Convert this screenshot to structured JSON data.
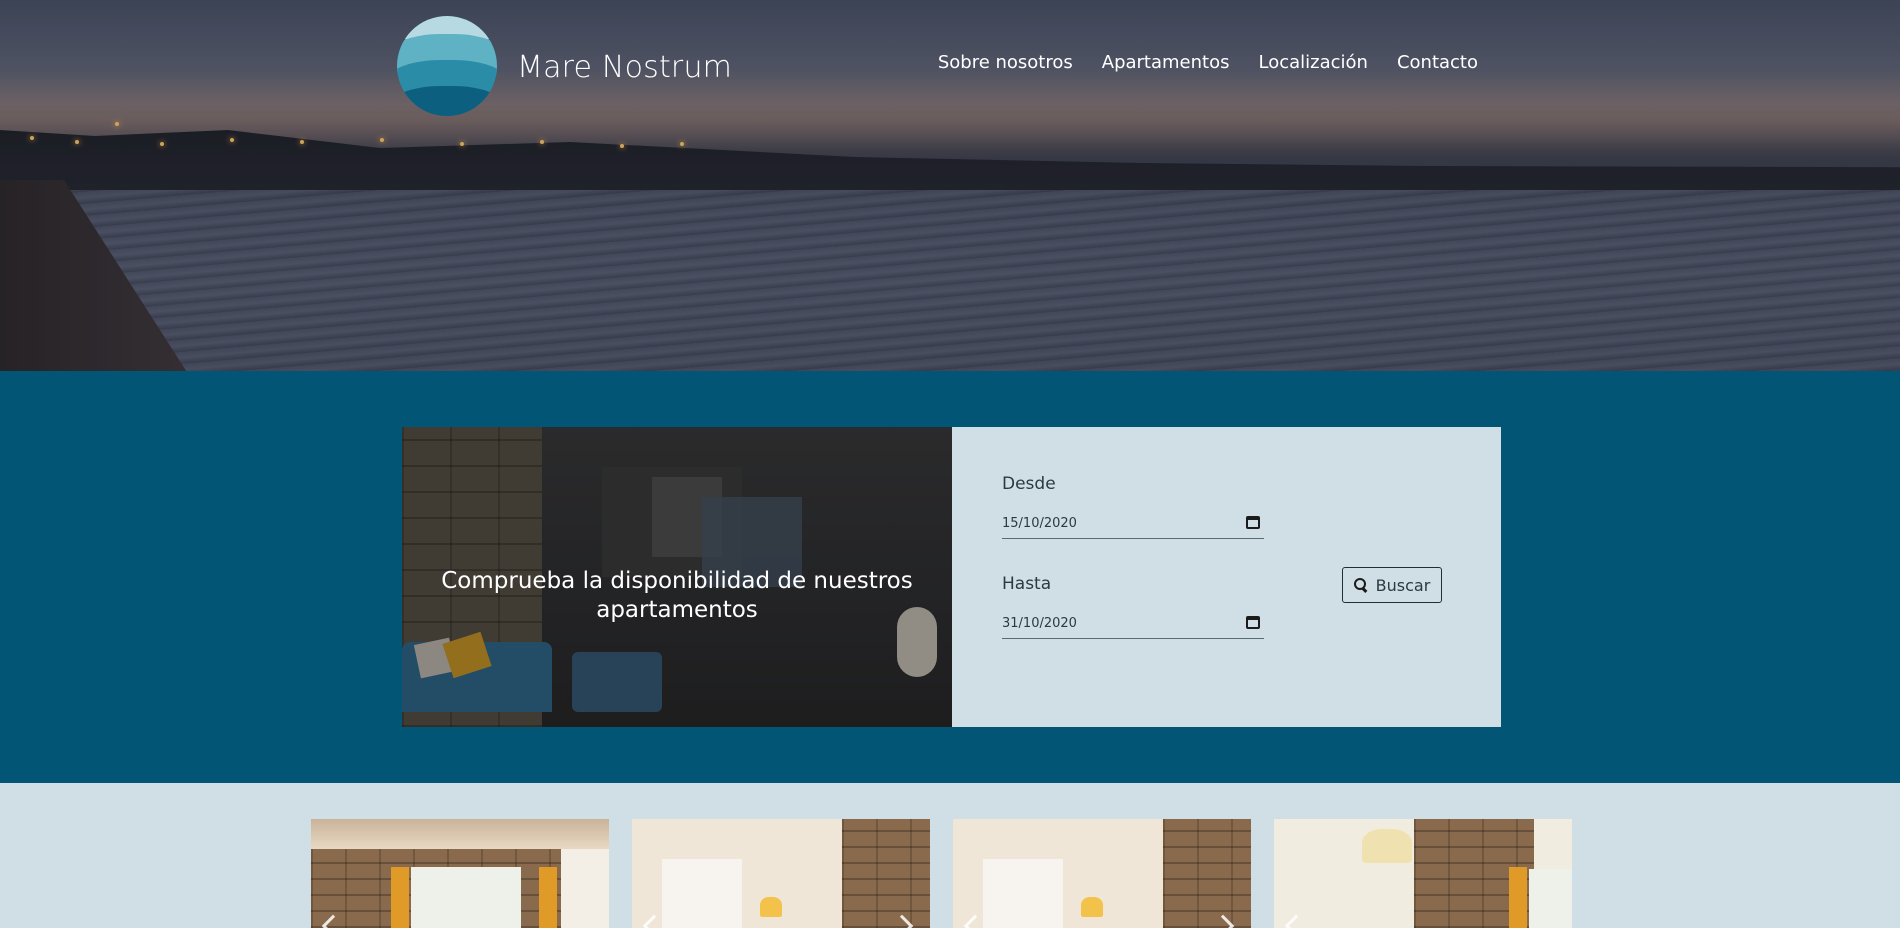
{
  "header": {
    "brand": "Mare Nostrum",
    "nav": [
      {
        "label": "Sobre nosotros"
      },
      {
        "label": "Apartamentos"
      },
      {
        "label": "Localización"
      },
      {
        "label": "Contacto"
      }
    ]
  },
  "availability": {
    "headline": "Comprueba la disponibilidad de nuestros apartamentos",
    "from_label": "Desde",
    "from_value": "15/10/2020",
    "to_label": "Hasta",
    "to_value": "31/10/2020",
    "search_label": "Buscar"
  },
  "gallery": {
    "items": [
      {
        "name": "apartment-photo-1"
      },
      {
        "name": "apartment-photo-2"
      },
      {
        "name": "apartment-photo-3"
      },
      {
        "name": "apartment-photo-4"
      }
    ]
  },
  "colors": {
    "band": "#025574",
    "panel": "#cfdfe5",
    "white": "#ffffff"
  },
  "icons": [
    "logo-icon",
    "calendar-icon",
    "search-icon",
    "chevron-left-icon",
    "chevron-right-icon"
  ]
}
